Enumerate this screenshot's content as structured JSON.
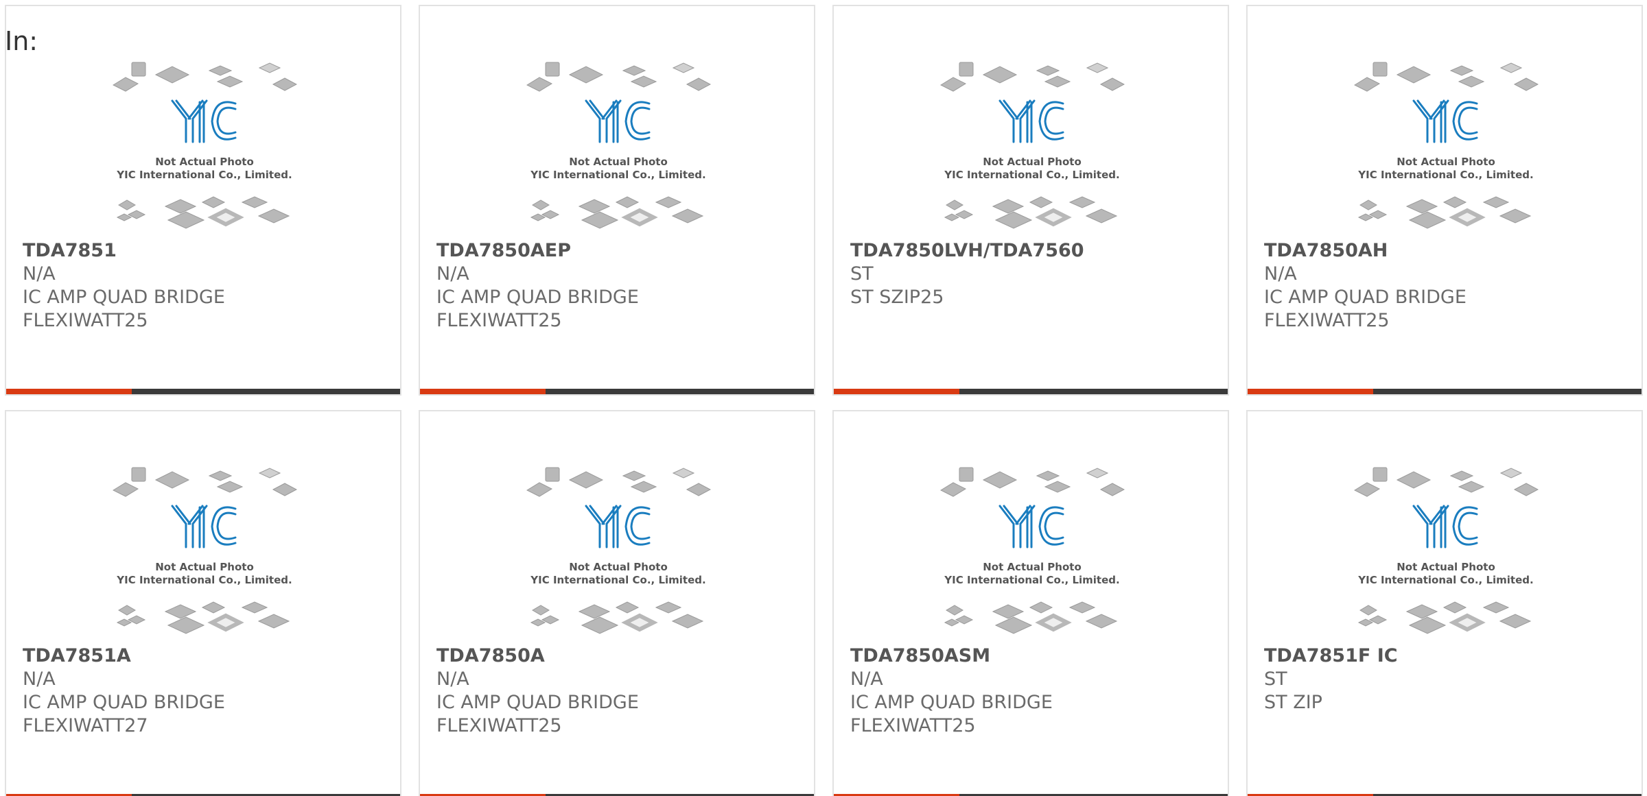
{
  "header": {
    "in_label": "In:"
  },
  "placeholder": {
    "line1": "Not Actual Photo",
    "line2": "YIC International Co., Limited.",
    "logo_text": "YIC",
    "logo_color": "#1a7dbf",
    "chip_color": "#b8b8b8"
  },
  "colors": {
    "accent": "#d93a12",
    "bar": "#3a3a3a",
    "border": "#e2e2e2",
    "text": "#6a6a6a"
  },
  "products": [
    {
      "part": "TDA7851",
      "manufacturer": "N/A",
      "desc1": "IC AMP QUAD BRIDGE",
      "desc2": "FLEXIWATT25"
    },
    {
      "part": "TDA7850AEP",
      "manufacturer": "N/A",
      "desc1": "IC AMP QUAD BRIDGE",
      "desc2": "FLEXIWATT25"
    },
    {
      "part": "TDA7850LVH/TDA7560",
      "manufacturer": "ST",
      "desc1": "ST SZIP25",
      "desc2": ""
    },
    {
      "part": "TDA7850AH",
      "manufacturer": "N/A",
      "desc1": "IC AMP QUAD BRIDGE",
      "desc2": "FLEXIWATT25"
    },
    {
      "part": "TDA7851A",
      "manufacturer": "N/A",
      "desc1": "IC AMP QUAD BRIDGE",
      "desc2": "FLEXIWATT27"
    },
    {
      "part": "TDA7850A",
      "manufacturer": "N/A",
      "desc1": "IC AMP QUAD BRIDGE",
      "desc2": "FLEXIWATT25"
    },
    {
      "part": "TDA7850ASM",
      "manufacturer": "N/A",
      "desc1": "IC AMP QUAD BRIDGE",
      "desc2": "FLEXIWATT25"
    },
    {
      "part": "TDA7851F IC",
      "manufacturer": "ST",
      "desc1": "ST ZIP",
      "desc2": ""
    }
  ]
}
